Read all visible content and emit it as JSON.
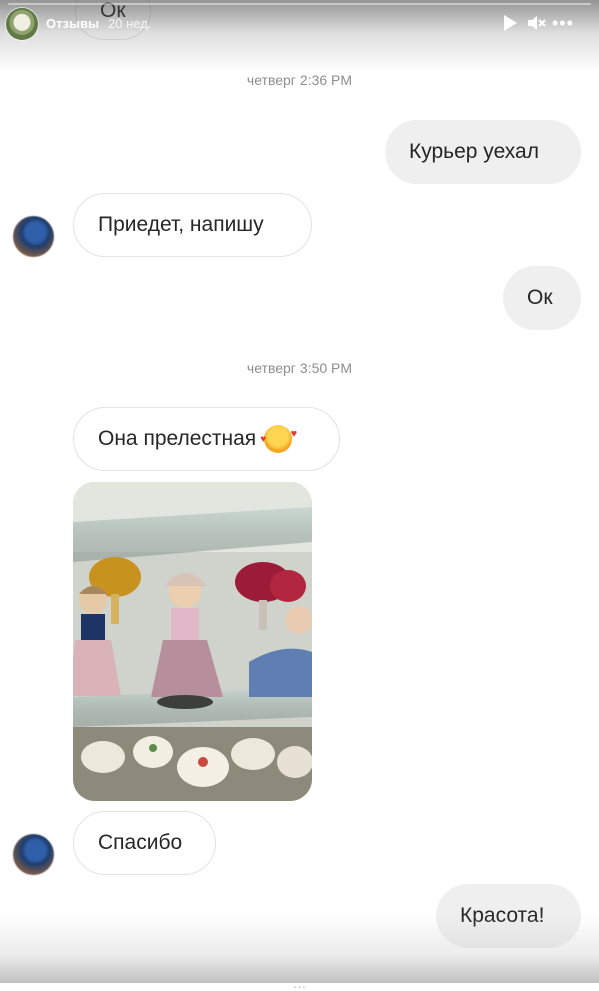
{
  "story": {
    "title": "Отзывы",
    "time_ago": "20 нед.",
    "progress": 0.0,
    "controls": [
      "play-icon",
      "mute-icon",
      "more-icon"
    ]
  },
  "chat": {
    "top_partial_message": "Ок",
    "groups": [
      {
        "timestamp_day": "четверг",
        "timestamp_time": "2:36 PM"
      },
      {
        "timestamp_day": "четверг",
        "timestamp_time": "3:50 PM"
      }
    ],
    "messages": [
      {
        "side": "out",
        "text": "Курьер уехал"
      },
      {
        "side": "in",
        "text": "Приедет, напишу"
      },
      {
        "side": "out",
        "text": "Ок"
      },
      {
        "side": "in",
        "text": "Она прелестная",
        "emoji": "smiling-face-with-hearts"
      },
      {
        "side": "in",
        "type": "photo",
        "description_icon": "photo-porcelain-figurines"
      },
      {
        "side": "in",
        "text": "Спасибо"
      },
      {
        "side": "out",
        "text": "Красота!"
      }
    ],
    "bottom_partial_timestamp": "…"
  },
  "colors": {
    "incoming_bubble": "#ffffff",
    "outgoing_bubble": "#efefef",
    "timestamp": "#8e8e8e",
    "text": "#262626"
  }
}
